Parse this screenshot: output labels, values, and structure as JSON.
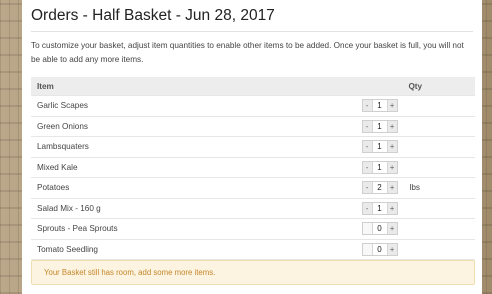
{
  "page": {
    "title": "Orders - Half Basket - Jun 28, 2017",
    "intro": "To customize your basket, adjust item quantities to enable other items to be added. Once your basket is full, you will not be able to add any more items."
  },
  "table": {
    "headers": {
      "item": "Item",
      "qty": "Qty"
    },
    "rows": [
      {
        "name": "Garlic Scapes",
        "qty": "1",
        "minus": "-",
        "plus": "+",
        "unit": ""
      },
      {
        "name": "Green Onions",
        "qty": "1",
        "minus": "-",
        "plus": "+",
        "unit": ""
      },
      {
        "name": "Lambsquaters",
        "qty": "1",
        "minus": "-",
        "plus": "+",
        "unit": ""
      },
      {
        "name": "Mixed Kale",
        "qty": "1",
        "minus": "-",
        "plus": "+",
        "unit": ""
      },
      {
        "name": "Potatoes",
        "qty": "2",
        "minus": "-",
        "plus": "+",
        "unit": "lbs"
      },
      {
        "name": "Salad Mix - 160 g",
        "qty": "1",
        "minus": "-",
        "plus": "+",
        "unit": ""
      },
      {
        "name": "Sprouts - Pea Sprouts",
        "qty": "0",
        "minus": "",
        "plus": "+",
        "unit": ""
      },
      {
        "name": "Tomato Seedling",
        "qty": "0",
        "minus": "",
        "plus": "+",
        "unit": ""
      }
    ]
  },
  "alert": {
    "text": "Your Basket still has room, add some more items."
  }
}
